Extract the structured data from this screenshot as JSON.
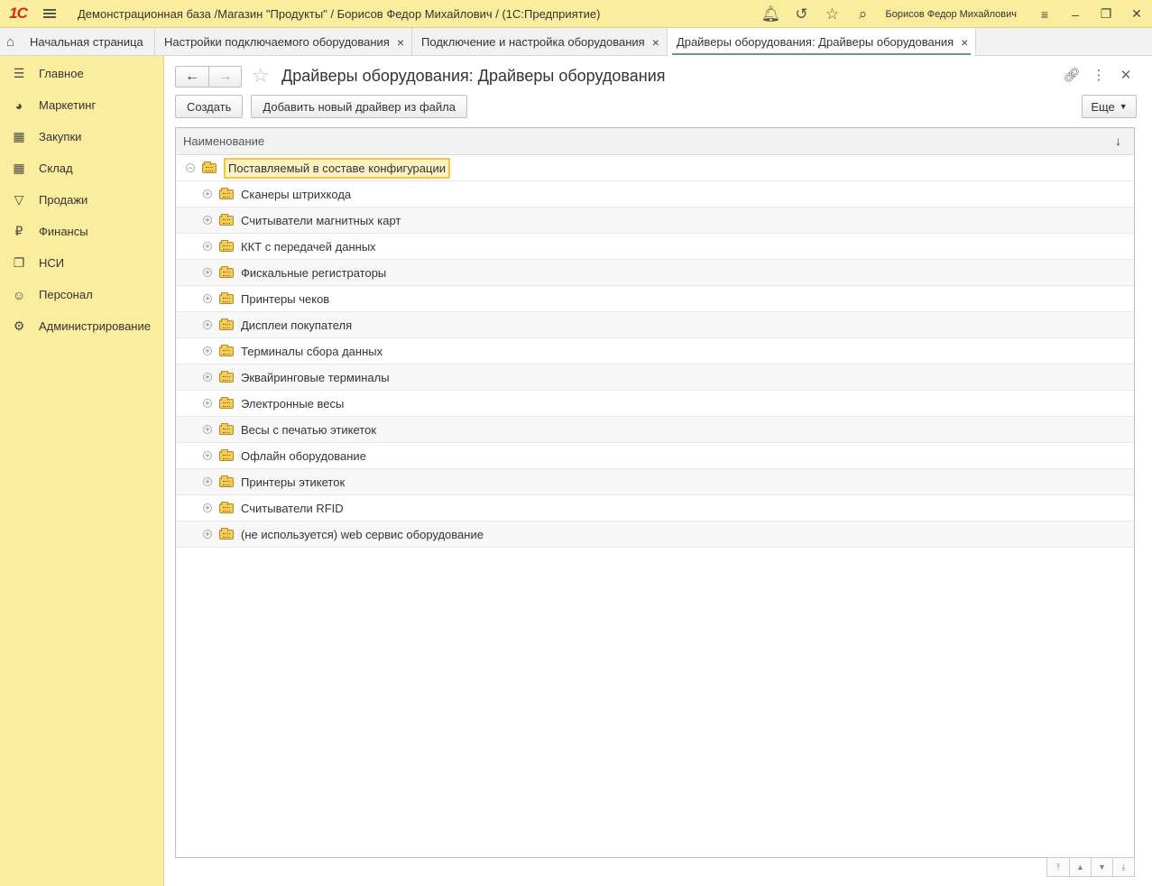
{
  "titlebar": {
    "logo": "1С",
    "title": "Демонстрационная база /Магазин \"Продукты\" / Борисов Федор Михайлович /  (1С:Предприятие)",
    "user": "Борисов Федор Михайлович",
    "icons": [
      "bell-icon",
      "history-icon",
      "star-icon",
      "search-icon"
    ]
  },
  "tabs": [
    {
      "label": "Начальная страница",
      "home": true
    },
    {
      "label": "Настройки подключаемого оборудования",
      "close": "×"
    },
    {
      "label": "Подключение и настройка оборудования",
      "close": "×"
    },
    {
      "label": "Драйверы оборудования: Драйверы оборудования",
      "close": "×",
      "active": true
    }
  ],
  "sidebar": {
    "items": [
      {
        "label": "Главное",
        "icon": "list-icon"
      },
      {
        "label": "Маркетинг",
        "icon": "pie-chart-icon"
      },
      {
        "label": "Закупки",
        "icon": "cart-icon"
      },
      {
        "label": "Склад",
        "icon": "grid-icon"
      },
      {
        "label": "Продажи",
        "icon": "basket-icon"
      },
      {
        "label": "Финансы",
        "icon": "ruble-icon"
      },
      {
        "label": "НСИ",
        "icon": "documents-icon"
      },
      {
        "label": "Персонал",
        "icon": "person-icon"
      },
      {
        "label": "Администрирование",
        "icon": "gear-icon"
      }
    ]
  },
  "form": {
    "title": "Драйверы оборудования: Драйверы оборудования",
    "create_label": "Создать",
    "add_driver_label": "Добавить новый драйвер из файла",
    "more_label": "Еще"
  },
  "table": {
    "column": "Наименование",
    "root": "Поставляемый в составе конфигурации",
    "rows": [
      "Сканеры штрихкода",
      "Считыватели магнитных карт",
      "ККТ с передачей данных",
      "Фискальные регистраторы",
      "Принтеры чеков",
      "Дисплеи покупателя",
      "Терминалы сбора данных",
      "Эквайринговые терминалы",
      "Электронные весы",
      "Весы с печатью этикеток",
      "Офлайн оборудование",
      "Принтеры этикеток",
      "Считыватели RFID",
      "(не используется) web сервис оборудование"
    ]
  },
  "colors": {
    "accent_yellow": "#fbed9e",
    "active_tab_line": "#58a66b",
    "selection_border": "#f5c53c"
  }
}
